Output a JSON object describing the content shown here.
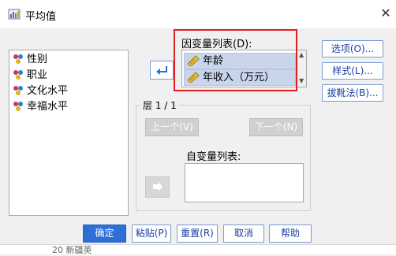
{
  "window": {
    "title": "平均值",
    "close_glyph": "✕"
  },
  "source_list": {
    "items": [
      {
        "label": "性别",
        "icon": "nominal-variable-icon"
      },
      {
        "label": "职业",
        "icon": "nominal-variable-icon"
      },
      {
        "label": "文化水平",
        "icon": "nominal-variable-icon"
      },
      {
        "label": "幸福水平",
        "icon": "nominal-variable-icon"
      }
    ]
  },
  "dependent": {
    "label": "因变量列表(D):",
    "items": [
      {
        "label": "年龄",
        "icon": "scale-variable-icon"
      },
      {
        "label": "年收入（万元）",
        "icon": "scale-variable-icon"
      }
    ]
  },
  "side_buttons": {
    "options": "选项(O)...",
    "style": "样式(L)...",
    "bootstrap": "拔靴法(B)..."
  },
  "layer": {
    "label": "层 1 / 1",
    "prev": "上一个(V)",
    "next": "下一个(N)",
    "independent_label": "自变量列表:"
  },
  "bottom_buttons": {
    "ok": "确定",
    "paste": "粘贴(P)",
    "reset": "重置(R)",
    "cancel": "取消",
    "help": "帮助"
  },
  "background_text": "20 新疆英",
  "colors": {
    "accent": "#2d6ed8",
    "highlight_box": "#e02020",
    "selected_row": "#c9d5ea"
  }
}
